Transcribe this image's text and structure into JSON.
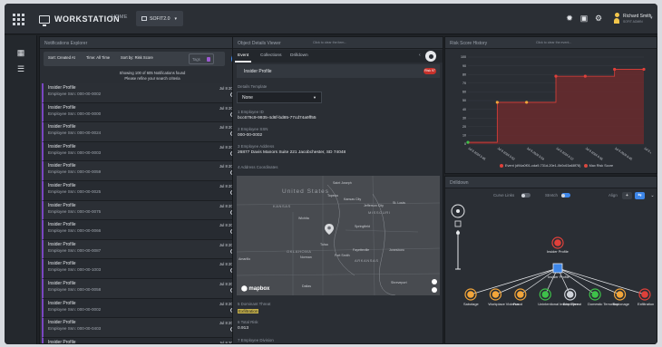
{
  "app": {
    "title": "WORKSTATION",
    "nav_home": "HOME",
    "active_tab": "SOFIT2.0"
  },
  "user": {
    "name": "Richard Smith",
    "role": "SOFIT ADMIN"
  },
  "colors": {
    "accent": "#3d86e8",
    "danger": "#c7312b",
    "purple": "#7a46c2",
    "progress": "#3ec24a"
  },
  "notifications": {
    "title": "Notifications Explorer",
    "filters": {
      "sort_date": "Sort: Created At",
      "time": "Time: All Time",
      "sort_by": "Sort by: Risk Score",
      "tags": "Tags"
    },
    "showing_line1": "Showing 100 of 605 Notifications found",
    "showing_line2": "Please refine your search criteria",
    "items": [
      {
        "title": "Insider Profile",
        "sub": "Employee Ssn: 000-00-0002",
        "date": "Jul 8 2024, 6:45:25 PM"
      },
      {
        "title": "Insider Profile",
        "sub": "Employee Ssn: 000-00-0000",
        "date": "Jul 8 2024, 5:52:28 PM"
      },
      {
        "title": "Insider Profile",
        "sub": "Employee Ssn: 000-00-0024",
        "date": "Jul 8 2024, 5:54:27 PM"
      },
      {
        "title": "Insider Profile",
        "sub": "Employee Ssn: 000-00-0003",
        "date": "Jul 8 2024, 5:54:30 PM"
      },
      {
        "title": "Insider Profile",
        "sub": "Employee Ssn: 000-00-0059",
        "date": "Jul 8 2024, 5:52:26 PM"
      },
      {
        "title": "Insider Profile",
        "sub": "Employee Ssn: 000-00-0025",
        "date": "Jul 8 2024, 6:36:17 PM"
      },
      {
        "title": "Insider Profile",
        "sub": "Employee Ssn: 000-00-0075",
        "date": "Jul 8 2024, 6:50:10 PM"
      },
      {
        "title": "Insider Profile",
        "sub": "Employee Ssn: 000-00-0066",
        "date": "Jul 8 2024, 5:52:13 PM"
      },
      {
        "title": "Insider Profile",
        "sub": "Employee Ssn: 000-00-0087",
        "date": "Jul 8 2024, 6:48:51 PM"
      },
      {
        "title": "Insider Profile",
        "sub": "Employee Ssn: 000-00-1003",
        "date": "Jul 8 2024, 5:46:09 PM"
      },
      {
        "title": "Insider Profile",
        "sub": "Employee Ssn: 000-00-0058",
        "date": "Jul 8 2024, 6:12:39 PM"
      },
      {
        "title": "Insider Profile",
        "sub": "Employee Ssn: 000-00-0002",
        "date": "Jul 8 2024, 5:53:05 PM"
      },
      {
        "title": "Insider Profile",
        "sub": "Employee Ssn: 000-00-0403",
        "date": "Jul 8 2024, 6:52:30 PM"
      },
      {
        "title": "Insider Profile",
        "sub": "",
        "date": "Jul 8 2024, 6:31:14 PM"
      }
    ]
  },
  "details": {
    "title": "Object Details Viewer",
    "hint": "Click to clear the item...",
    "tabs": [
      "Event",
      "Collections",
      "Drilldown"
    ],
    "profile_label": "Insider Profile",
    "profile_badge": "Risk 97",
    "template_label": "Details Template",
    "template_value": "None",
    "fields": [
      {
        "label": "1 Employee ID",
        "value": "bcc679c9-9935-4d6f-bd85-77cd74a9ff55"
      },
      {
        "label": "2 Employee SSN",
        "value": "000-00-0002"
      },
      {
        "label": "3 Employee Address",
        "value": "26877 Davis Manors Suite 221 Jacobchester, SD 74048"
      },
      {
        "label": "4 Address Coordinates",
        "value": ""
      }
    ],
    "threat_label": "5 Dominant Threat",
    "threat_value": "Exfiltration",
    "risk_label": "6 Total Risk",
    "risk_value": "0.913",
    "more_label": "7 Employee Division",
    "map": {
      "country": "United States",
      "states": [
        "KANSAS",
        "MISSOURI",
        "OKLAHOMA",
        "ARKANSAS"
      ],
      "cities": [
        "Saint Joseph",
        "Topeka",
        "Kansas City",
        "Jefferson City",
        "St. Louis",
        "Wichita",
        "Springfield",
        "Tulsa",
        "Fayetteville",
        "Jonesboro",
        "Amarillo",
        "Norman",
        "Fort Smith",
        "Dallas",
        "Shreveport"
      ],
      "attribution": "mapbox"
    }
  },
  "risk_history": {
    "title": "Risk Score History",
    "hint": "Click to clear the event..."
  },
  "chart_data": {
    "type": "line",
    "title": "",
    "x": [
      "Jul 8 2024 5:45",
      "Jul 8 2024 5:52",
      "Jul 8 2024 5:54",
      "Jul 8 2024 6:12",
      "Jul 8 2024 6:36",
      "Jul 8 2024 6:45",
      "Jul 8 2024 6:52"
    ],
    "ylim": [
      0,
      100
    ],
    "yticks": [
      0,
      10,
      20,
      30,
      40,
      50,
      60,
      70,
      80,
      90,
      100
    ],
    "series": [
      {
        "name": "Event (d94a0f01-cda9-731d-20e1-0b0c63a68f78)",
        "values": [
          2,
          48,
          48,
          78,
          78,
          86,
          86
        ],
        "color": "#e0403a"
      },
      {
        "name": "Max Risk Score",
        "values": [
          2,
          48,
          48,
          78,
          78,
          86,
          86
        ],
        "color": "#d9483f"
      }
    ],
    "point_colors": [
      "#3ec24a",
      "#f2a53a",
      "#f2a53a",
      "#e0403a",
      "#e0403a",
      "#e0403a",
      "#e0403a"
    ]
  },
  "drilldown": {
    "title": "Drilldown",
    "curve_links": "Curve Links",
    "stretch": "Stretch",
    "align": "Align",
    "root": "Insider Profile",
    "mid": "Insider Profile",
    "leaves": [
      {
        "label": "Sabotage",
        "color": "#f2a53a"
      },
      {
        "label": "Workplace Violence",
        "color": "#f2a53a"
      },
      {
        "label": "Fraud",
        "color": "#f2a53a"
      },
      {
        "label": "Unintentional Insider Threat",
        "color": "#3ec24a"
      },
      {
        "label": "Employee",
        "color": "#cfd3da"
      },
      {
        "label": "Domestic Terrorism",
        "color": "#3ec24a"
      },
      {
        "label": "Espionage",
        "color": "#f2a53a"
      },
      {
        "label": "Exfiltration",
        "color": "#e0403a"
      }
    ]
  }
}
